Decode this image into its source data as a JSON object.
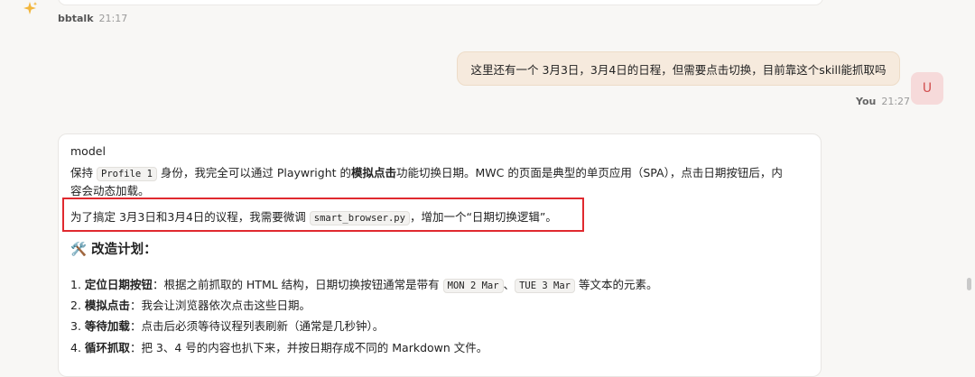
{
  "bot": {
    "name": "bbtalk",
    "time": "21:17",
    "avatar_icon": "sparkle-icon"
  },
  "user": {
    "message": "这里还有一个 3月3日，3月4日的日程，但需要点击切换，目前靠这个skill能抓取吗",
    "name": "You",
    "time": "21:27",
    "avatar_letter": "U"
  },
  "model_reply": {
    "label": "model",
    "p1_a": "保持",
    "p1_code": "Profile 1",
    "p1_b": "身份，我完全可以通过 Playwright 的",
    "p1_bold": "模拟点击",
    "p1_c": "功能切换日期。MWC 的页面是典型的单页应用（SPA），点击日期按钮后，内",
    "p1_d": "容会动态加载。",
    "p2_a": "为了搞定 3月3日和3月4日的议程，我需要微调",
    "p2_code": "smart_browser.py",
    "p2_b": "，增加一个“日期切换逻辑”。",
    "plan_icon": "🛠️",
    "plan_title": "改造计划：",
    "steps": [
      {
        "num": "1.",
        "bold": "定位日期按钮",
        "a": "：根据之前抓取的 HTML 结构，日期切换按钮通常是带有",
        "code1": "MON 2 Mar",
        "sep": "、",
        "code2": "TUE 3 Mar",
        "b": "等文本的元素。"
      },
      {
        "num": "2.",
        "bold": "模拟点击",
        "a": "：我会让浏览器依次点击这些日期。"
      },
      {
        "num": "3.",
        "bold": "等待加载",
        "a": "：点击后必须等待议程列表刷新（通常是几秒钟）。"
      },
      {
        "num": "4.",
        "bold": "循环抓取",
        "a": "：把 3、4 号的内容也扒下来，并按日期存成不同的 Markdown 文件。"
      }
    ]
  },
  "colors": {
    "highlight": "#e0292f",
    "user_bubble": "#f6eadd",
    "avatar_text": "#d14d4d"
  }
}
